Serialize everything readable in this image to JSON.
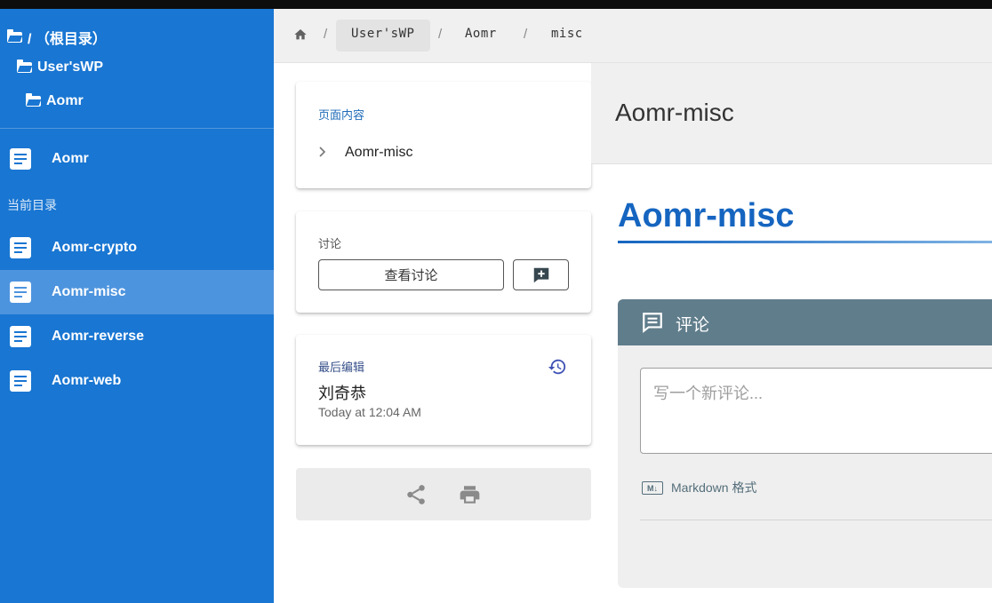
{
  "sidebar": {
    "tree": [
      {
        "label": "/  （根目录）"
      },
      {
        "label": "User'sWP"
      },
      {
        "label": "Aomr"
      }
    ],
    "parent_item": {
      "label": "Aomr"
    },
    "section_label": "当前目录",
    "items": [
      {
        "label": "Aomr-crypto",
        "active": false
      },
      {
        "label": "Aomr-misc",
        "active": true
      },
      {
        "label": "Aomr-reverse",
        "active": false
      },
      {
        "label": "Aomr-web",
        "active": false
      }
    ]
  },
  "breadcrumb": {
    "items": [
      "User'sWP",
      "Aomr",
      "misc"
    ],
    "separator": "/"
  },
  "toc_card": {
    "label": "页面内容",
    "entry": "Aomr-misc"
  },
  "discussion_card": {
    "label": "讨论",
    "view_button": "查看讨论"
  },
  "last_edit_card": {
    "label": "最后编辑",
    "author": "刘奇恭",
    "time": "Today at 12:04 AM"
  },
  "page": {
    "header_title": "Aomr-misc",
    "title": "Aomr-misc"
  },
  "comments": {
    "title": "评论",
    "placeholder": "写一个新评论...",
    "markdown_badge": "M↓",
    "markdown_label": "Markdown 格式"
  },
  "colors": {
    "sidebar": "#1976d2",
    "accent": "#1565c0",
    "comments_header": "#607d8b"
  }
}
